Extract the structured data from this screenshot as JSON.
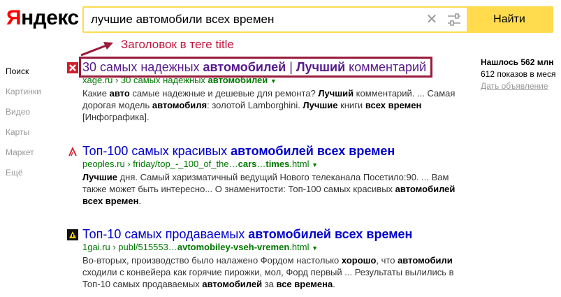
{
  "logo": {
    "first_letter": "Я",
    "rest": "ндекс"
  },
  "search": {
    "query": "лучшие автомобили всех времен",
    "clear_icon": "close-icon",
    "settings_icon": "filters-icon",
    "button_label": "Найти"
  },
  "sidenav": [
    "Поиск",
    "Картинки",
    "Видео",
    "Карты",
    "Маркет",
    "Ещё"
  ],
  "annotation": {
    "text": "Заголовок в теге title",
    "color": "#c2143b"
  },
  "right": {
    "found": "Нашлось 562 млн",
    "shows": "612 показов в меся",
    "ad_link": "Дать объявление"
  },
  "results": [
    {
      "title_parts": [
        "30 самых надежных ",
        "автомобилей",
        " | ",
        "Лучший",
        " комментарий"
      ],
      "url_parts": [
        "xage.ru",
        " › 30 самых надежных ",
        "автомобилей"
      ],
      "snippet_parts": [
        "Какие ",
        "авто",
        " самые надежные и дешевые для ремонта? ",
        "Лучший",
        " комментарий. ... Самая дорогая модель ",
        "автомобиля",
        ": золотой Lamborghini. ",
        "Лучшие",
        " книги ",
        "всех времен",
        " [Инфографика]."
      ]
    },
    {
      "title_parts": [
        "Топ-100 самых красивых ",
        "автомобилей всех времен"
      ],
      "url_parts": [
        "peoples.ru",
        " › friday/top_-_100_of_the…",
        "cars",
        "…",
        "times",
        ".html"
      ],
      "snippet_parts": [
        "Лучшие",
        " дня. Самый харизматичный ведущий Нового телеканала Посетило:90. ... Вам также может быть интересно... О знаменитости: Топ-100 самых красивых ",
        "автомобилей",
        " ",
        "всех времен",
        "."
      ]
    },
    {
      "title_parts": [
        "Топ-10 самых продаваемых ",
        "автомобилей всех времен"
      ],
      "url_parts": [
        "1gai.ru",
        " › publ/515553…",
        "avtomobiley-vseh-vremen",
        ".html"
      ],
      "snippet_parts": [
        "Во-вторых, производство было налажено Фордом настолько ",
        "хорошо",
        ", что ",
        "автомобили",
        " сходили с конвейера как горячие пирожки, мол, Форд первый ... Результаты вылились в Топ-10 самых продаваемых ",
        "автомобилей",
        " за ",
        "все времена",
        "."
      ]
    }
  ]
}
